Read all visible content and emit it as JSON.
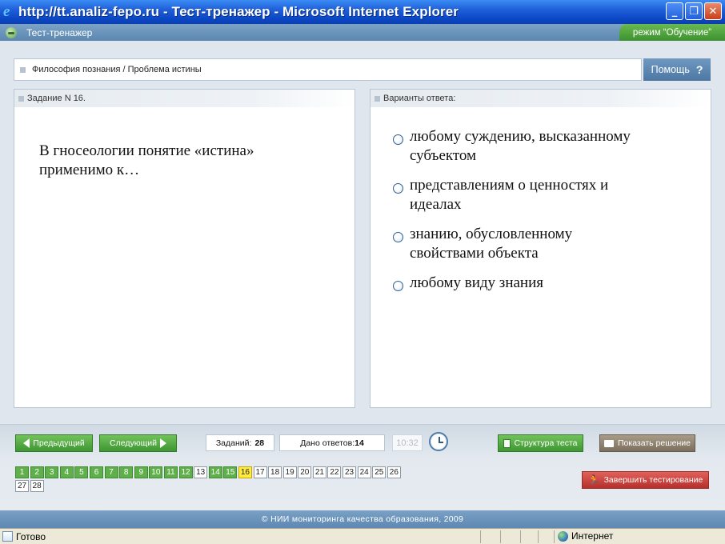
{
  "window": {
    "title": "http://tt.analiz-fepo.ru - Тест-тренажер - Microsoft Internet Explorer",
    "minimize": "_",
    "maximize": "❐",
    "close": "✕"
  },
  "app": {
    "name": "Тест-тренажер",
    "mode": "режим “Обучение”"
  },
  "breadcrumb": "Философия познания / Проблема истины",
  "help": {
    "label": "Помощь",
    "icon": "?"
  },
  "task": {
    "header": "Задание N 16.",
    "question": "В гносеологии  понятие «истина»\nприменимо к…"
  },
  "answers": {
    "header": "Варианты ответа:",
    "options": [
      "любому суждению, высказанному субъектом",
      "представлениям о ценностях и идеалах",
      "знанию, обусловленному свойствами объекта",
      "любому виду знания"
    ]
  },
  "controls": {
    "prev": "Предыдущий",
    "next": "Следующий",
    "tasks_label": "Заданий:",
    "tasks_count": "28",
    "answered_label": "Дано ответов:",
    "answered_count": "14",
    "timer": "10:32",
    "structure": "Структура теста",
    "show_solution": "Показать решение",
    "finish": "Завершить тестирование"
  },
  "question_nav": [
    {
      "n": "1",
      "state": "answered"
    },
    {
      "n": "2",
      "state": "answered"
    },
    {
      "n": "3",
      "state": "answered"
    },
    {
      "n": "4",
      "state": "answered"
    },
    {
      "n": "5",
      "state": "answered"
    },
    {
      "n": "6",
      "state": "answered"
    },
    {
      "n": "7",
      "state": "answered"
    },
    {
      "n": "8",
      "state": "answered"
    },
    {
      "n": "9",
      "state": "answered"
    },
    {
      "n": "10",
      "state": "answered"
    },
    {
      "n": "11",
      "state": "answered"
    },
    {
      "n": "12",
      "state": "answered"
    },
    {
      "n": "13",
      "state": "pending"
    },
    {
      "n": "14",
      "state": "answered"
    },
    {
      "n": "15",
      "state": "answered"
    },
    {
      "n": "16",
      "state": "current"
    },
    {
      "n": "17",
      "state": "pending"
    },
    {
      "n": "18",
      "state": "pending"
    },
    {
      "n": "19",
      "state": "pending"
    },
    {
      "n": "20",
      "state": "pending"
    },
    {
      "n": "21",
      "state": "pending"
    },
    {
      "n": "22",
      "state": "pending"
    },
    {
      "n": "23",
      "state": "pending"
    },
    {
      "n": "24",
      "state": "pending"
    },
    {
      "n": "25",
      "state": "pending"
    },
    {
      "n": "26",
      "state": "pending"
    },
    {
      "n": "27",
      "state": "pending"
    },
    {
      "n": "28",
      "state": "pending"
    }
  ],
  "footer": "© НИИ мониторинга качества образования, 2009",
  "statusbar": {
    "status": "Готово",
    "zone": "Интернет"
  },
  "colors": {
    "answered": "#5fb04a",
    "current": "#ffec3d",
    "pending": "#ffffff",
    "finish_button": "#b7302b",
    "nav_button": "#3e9634"
  }
}
